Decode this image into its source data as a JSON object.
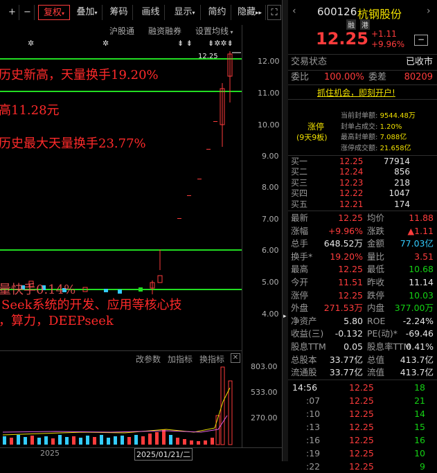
{
  "toolbar": {
    "adjust": "复权",
    "overlay": "叠加",
    "chips": "筹码",
    "draw": "画线",
    "display": "显示",
    "simple": "简约",
    "hide": "隐藏"
  },
  "subbar": {
    "hsgt": "沪股通",
    "margin": "融资融券",
    "ma_setting": "设置均线"
  },
  "annotations": {
    "a1": "历史新高，天量换手19.20%",
    "a2": "高11.28元",
    "a3": "历史最大天量换手23.77%",
    "a4": "量快手0.14%",
    "a5": "Seek系统的开发、应用等核心技",
    "a6": "，算力，DEEPseek"
  },
  "price_chart": {
    "y_ticks": [
      "12.00",
      "11.00",
      "10.00",
      "9.00",
      "8.00",
      "7.00",
      "6.00",
      "5.00",
      "4.00"
    ],
    "price_marker": "12.25"
  },
  "indicator_panel": {
    "change_params": "改参数",
    "add_indicator": "加指标",
    "switch_indicator": "换指标",
    "y_ticks": [
      "803.00",
      "533.00",
      "270.00"
    ],
    "x_labels": [
      "2025",
      "2025/01/21/二"
    ]
  },
  "quote": {
    "code": "600126",
    "name": "杭钢股份",
    "tag1": "融",
    "tag2": "港",
    "price": "12.25",
    "change": "+1.11",
    "change_pct": "+9.96%",
    "status_label": "交易状态",
    "status_value": "已收市",
    "wb_label": "委比",
    "wb_value": "100.00%",
    "wc_label": "委差",
    "wc_value": "80209",
    "promo": "抓住机会，即刻开户!",
    "limit_label": "涨停",
    "limit_sub": "(9天9板)",
    "limit_stats": [
      {
        "label": "当前封单额:",
        "value": "9544.48万"
      },
      {
        "label": "封单占成交:",
        "value": "1.20%"
      },
      {
        "label": "最高封单额:",
        "value": "7.088亿"
      },
      {
        "label": "涨停成交额:",
        "value": "21.658亿"
      }
    ],
    "bids": [
      {
        "label": "买一",
        "price": "12.25",
        "vol": "77914"
      },
      {
        "label": "买二",
        "price": "12.24",
        "vol": "856"
      },
      {
        "label": "买三",
        "price": "12.23",
        "vol": "218"
      },
      {
        "label": "买四",
        "price": "12.22",
        "vol": "1047"
      },
      {
        "label": "买五",
        "price": "12.21",
        "vol": "174"
      }
    ],
    "stats": [
      {
        "l1": "最新",
        "v1": "12.25",
        "l2": "均价",
        "v2": "11.88"
      },
      {
        "l1": "涨幅",
        "v1": "+9.96%",
        "l2": "涨跌",
        "v2": "▲1.11"
      },
      {
        "l1": "总手",
        "v1": "648.52万",
        "l2": "金额",
        "v2": "77.03亿"
      },
      {
        "l1": "换手*",
        "v1": "19.20%",
        "l2": "量比",
        "v2": "3.51"
      },
      {
        "l1": "最高",
        "v1": "12.25",
        "l2": "最低",
        "v2": "10.68"
      },
      {
        "l1": "今开",
        "v1": "11.51",
        "l2": "昨收",
        "v2": "11.14"
      },
      {
        "l1": "涨停",
        "v1": "12.25",
        "l2": "跌停",
        "v2": "10.03"
      },
      {
        "l1": "外盘",
        "v1": "271.53万",
        "l2": "内盘",
        "v2": "377.00万"
      },
      {
        "l1": "净资产",
        "v1": "5.80",
        "l2": "ROE",
        "v2": "-2.24%"
      },
      {
        "l1": "收益(三)",
        "v1": "-0.132",
        "l2": "PE(动)*",
        "v2": "-69.46"
      },
      {
        "l1": "股息TTM",
        "v1": "0.05",
        "l2": "股息率TTM",
        "v2": "0.41%"
      },
      {
        "l1": "总股本",
        "v1": "33.77亿",
        "l2": "总值",
        "v2": "413.7亿"
      },
      {
        "l1": "流通股",
        "v1": "33.77亿",
        "l2": "流值",
        "v2": "413.7亿"
      }
    ],
    "ticks": [
      {
        "time": "14:56",
        "price": "12.25",
        "vol": "18"
      },
      {
        "time": ":07",
        "price": "12.25",
        "vol": "21"
      },
      {
        "time": ":10",
        "price": "12.25",
        "vol": "14"
      },
      {
        "time": ":13",
        "price": "12.25",
        "vol": "15"
      },
      {
        "time": ":16",
        "price": "12.25",
        "vol": "16"
      },
      {
        "time": ":19",
        "price": "12.25",
        "vol": "10"
      },
      {
        "time": ":22",
        "price": "12.25",
        "vol": "9"
      }
    ]
  }
}
